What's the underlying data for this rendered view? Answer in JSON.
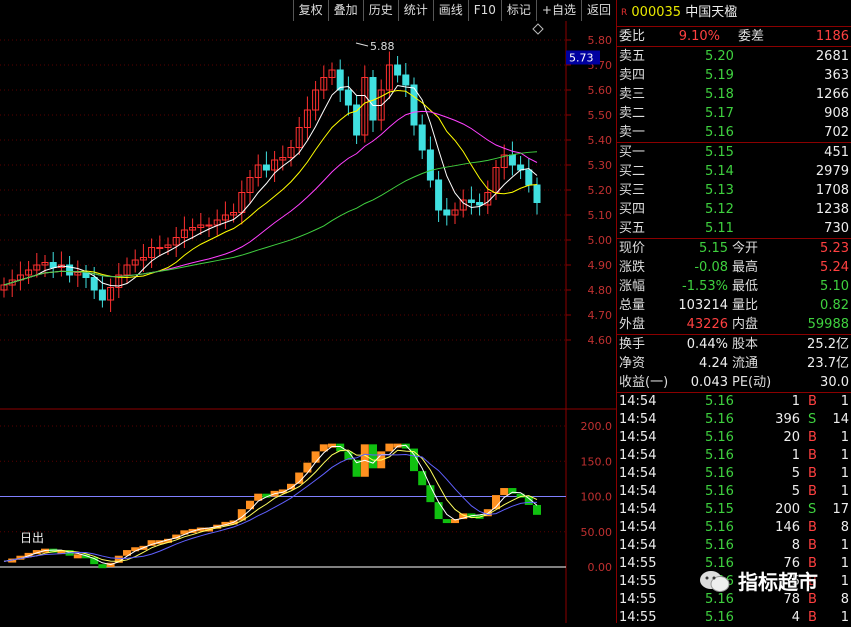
{
  "toolbar": [
    "复权",
    "叠加",
    "历史",
    "统计",
    "画线",
    "F10",
    "标记",
    "+自选",
    "返回"
  ],
  "stock": {
    "code": "000035",
    "name": "中国天楹",
    "badge": "R"
  },
  "wei": {
    "ratio_label": "委比",
    "ratio": "9.10%",
    "diff_label": "委差",
    "diff": "1186"
  },
  "asks": [
    {
      "label": "卖五",
      "price": "5.20",
      "vol": "2681"
    },
    {
      "label": "卖四",
      "price": "5.19",
      "vol": "363"
    },
    {
      "label": "卖三",
      "price": "5.18",
      "vol": "1266"
    },
    {
      "label": "卖二",
      "price": "5.17",
      "vol": "908"
    },
    {
      "label": "卖一",
      "price": "5.16",
      "vol": "702"
    }
  ],
  "bids": [
    {
      "label": "买一",
      "price": "5.15",
      "vol": "451"
    },
    {
      "label": "买二",
      "price": "5.14",
      "vol": "2979"
    },
    {
      "label": "买三",
      "price": "5.13",
      "vol": "1708"
    },
    {
      "label": "买四",
      "price": "5.12",
      "vol": "1238"
    },
    {
      "label": "买五",
      "price": "5.11",
      "vol": "730"
    }
  ],
  "stats": [
    {
      "l1": "现价",
      "v1": "5.15",
      "c1": "green",
      "l2": "今开",
      "v2": "5.23",
      "c2": "red"
    },
    {
      "l1": "涨跌",
      "v1": "-0.08",
      "c1": "green",
      "l2": "最高",
      "v2": "5.24",
      "c2": "red"
    },
    {
      "l1": "涨幅",
      "v1": "-1.53%",
      "c1": "green",
      "l2": "最低",
      "v2": "5.10",
      "c2": "green"
    },
    {
      "l1": "总量",
      "v1": "103214",
      "c1": "white",
      "l2": "量比",
      "v2": "0.82",
      "c2": "green"
    },
    {
      "l1": "外盘",
      "v1": "43226",
      "c1": "red",
      "l2": "内盘",
      "v2": "59988",
      "c2": "green"
    }
  ],
  "stats2": [
    {
      "l1": "换手",
      "v1": "0.44%",
      "l2": "股本",
      "v2": "25.2亿"
    },
    {
      "l1": "净资",
      "v1": "4.24",
      "l2": "流通",
      "v2": "23.7亿"
    },
    {
      "l1": "收益(一)",
      "v1": "0.043",
      "l2": "PE(动)",
      "v2": "30.0"
    }
  ],
  "ticks": [
    {
      "t": "14:54",
      "p": "5.16",
      "v": "1",
      "s": "B",
      "n": "1"
    },
    {
      "t": "14:54",
      "p": "5.16",
      "v": "396",
      "s": "S",
      "n": "14"
    },
    {
      "t": "14:54",
      "p": "5.16",
      "v": "20",
      "s": "B",
      "n": "1"
    },
    {
      "t": "14:54",
      "p": "5.16",
      "v": "1",
      "s": "B",
      "n": "1"
    },
    {
      "t": "14:54",
      "p": "5.16",
      "v": "5",
      "s": "B",
      "n": "1"
    },
    {
      "t": "14:54",
      "p": "5.16",
      "v": "5",
      "s": "B",
      "n": "1"
    },
    {
      "t": "14:54",
      "p": "5.15",
      "v": "200",
      "s": "S",
      "n": "17"
    },
    {
      "t": "14:54",
      "p": "5.16",
      "v": "146",
      "s": "B",
      "n": "8"
    },
    {
      "t": "14:54",
      "p": "5.16",
      "v": "8",
      "s": "B",
      "n": "1"
    },
    {
      "t": "14:55",
      "p": "5.16",
      "v": "76",
      "s": "B",
      "n": "1"
    },
    {
      "t": "14:55",
      "p": "5.16",
      "v": "5",
      "s": "B",
      "n": "1"
    },
    {
      "t": "14:55",
      "p": "5.16",
      "v": "78",
      "s": "B",
      "n": "8"
    },
    {
      "t": "14:55",
      "p": "5.16",
      "v": "4",
      "s": "B",
      "n": "1"
    }
  ],
  "price_axis": {
    "ticks": [
      "5.80",
      "5.70",
      "5.60",
      "5.50",
      "5.40",
      "5.30",
      "5.20",
      "5.10",
      "5.00",
      "4.90",
      "4.80",
      "4.70",
      "4.60"
    ],
    "current": "5.73",
    "high_label": "5.88"
  },
  "indicator_axis": {
    "ticks": [
      "200.0",
      "150.0",
      "100.0",
      "50.00",
      "0.00"
    ],
    "signal_label": "日出"
  },
  "watermark": "指标超市",
  "colors": {
    "up": "#ff3030",
    "down": "#40e0e0",
    "ma5": "#ffffff",
    "ma10": "#ffff00",
    "ma20": "#ff40ff",
    "ma60": "#40d040",
    "orange": "#ff9020",
    "green": "#10c010"
  }
}
